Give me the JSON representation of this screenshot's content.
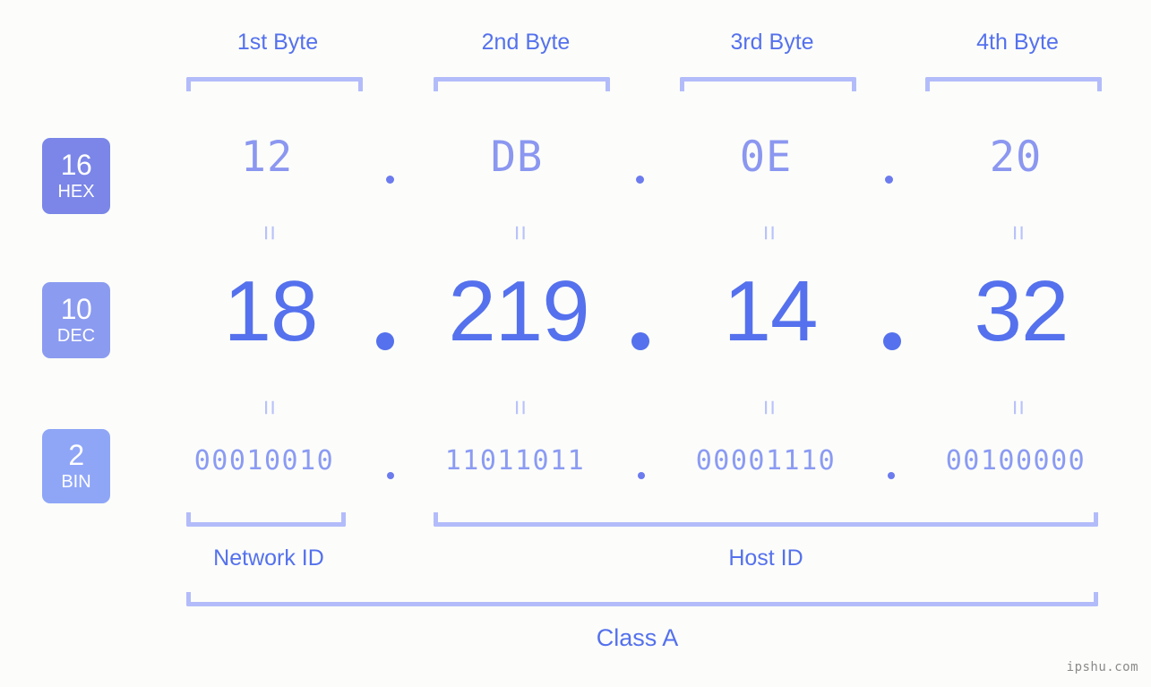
{
  "background_color": "#fcfdfa",
  "accent_color": "#5571ed",
  "light_accent_color": "#b3bcfa",
  "headers": [
    {
      "label": "1st Byte"
    },
    {
      "label": "2nd Byte"
    },
    {
      "label": "3rd Byte"
    },
    {
      "label": "4th Byte"
    }
  ],
  "bases": [
    {
      "number": "16",
      "name": "HEX",
      "badge_color": "#7b86e8"
    },
    {
      "number": "10",
      "name": "DEC",
      "badge_color": "#8b9bf0"
    },
    {
      "number": "2",
      "name": "BIN",
      "badge_color": "#8fa6f7"
    }
  ],
  "rows": {
    "hex": {
      "values": [
        "12",
        "DB",
        "0E",
        "20"
      ],
      "separator": "."
    },
    "dec": {
      "values": [
        "18",
        "219",
        "14",
        "32"
      ],
      "separator": "."
    },
    "bin": {
      "values": [
        "00010010",
        "11011011",
        "00001110",
        "00100000"
      ],
      "separator": "."
    }
  },
  "equals": {
    "symbol": "="
  },
  "id_labels": [
    {
      "label": "Network ID"
    },
    {
      "label": "Host ID"
    }
  ],
  "class_label": "Class A",
  "watermark": "ipshu.com"
}
